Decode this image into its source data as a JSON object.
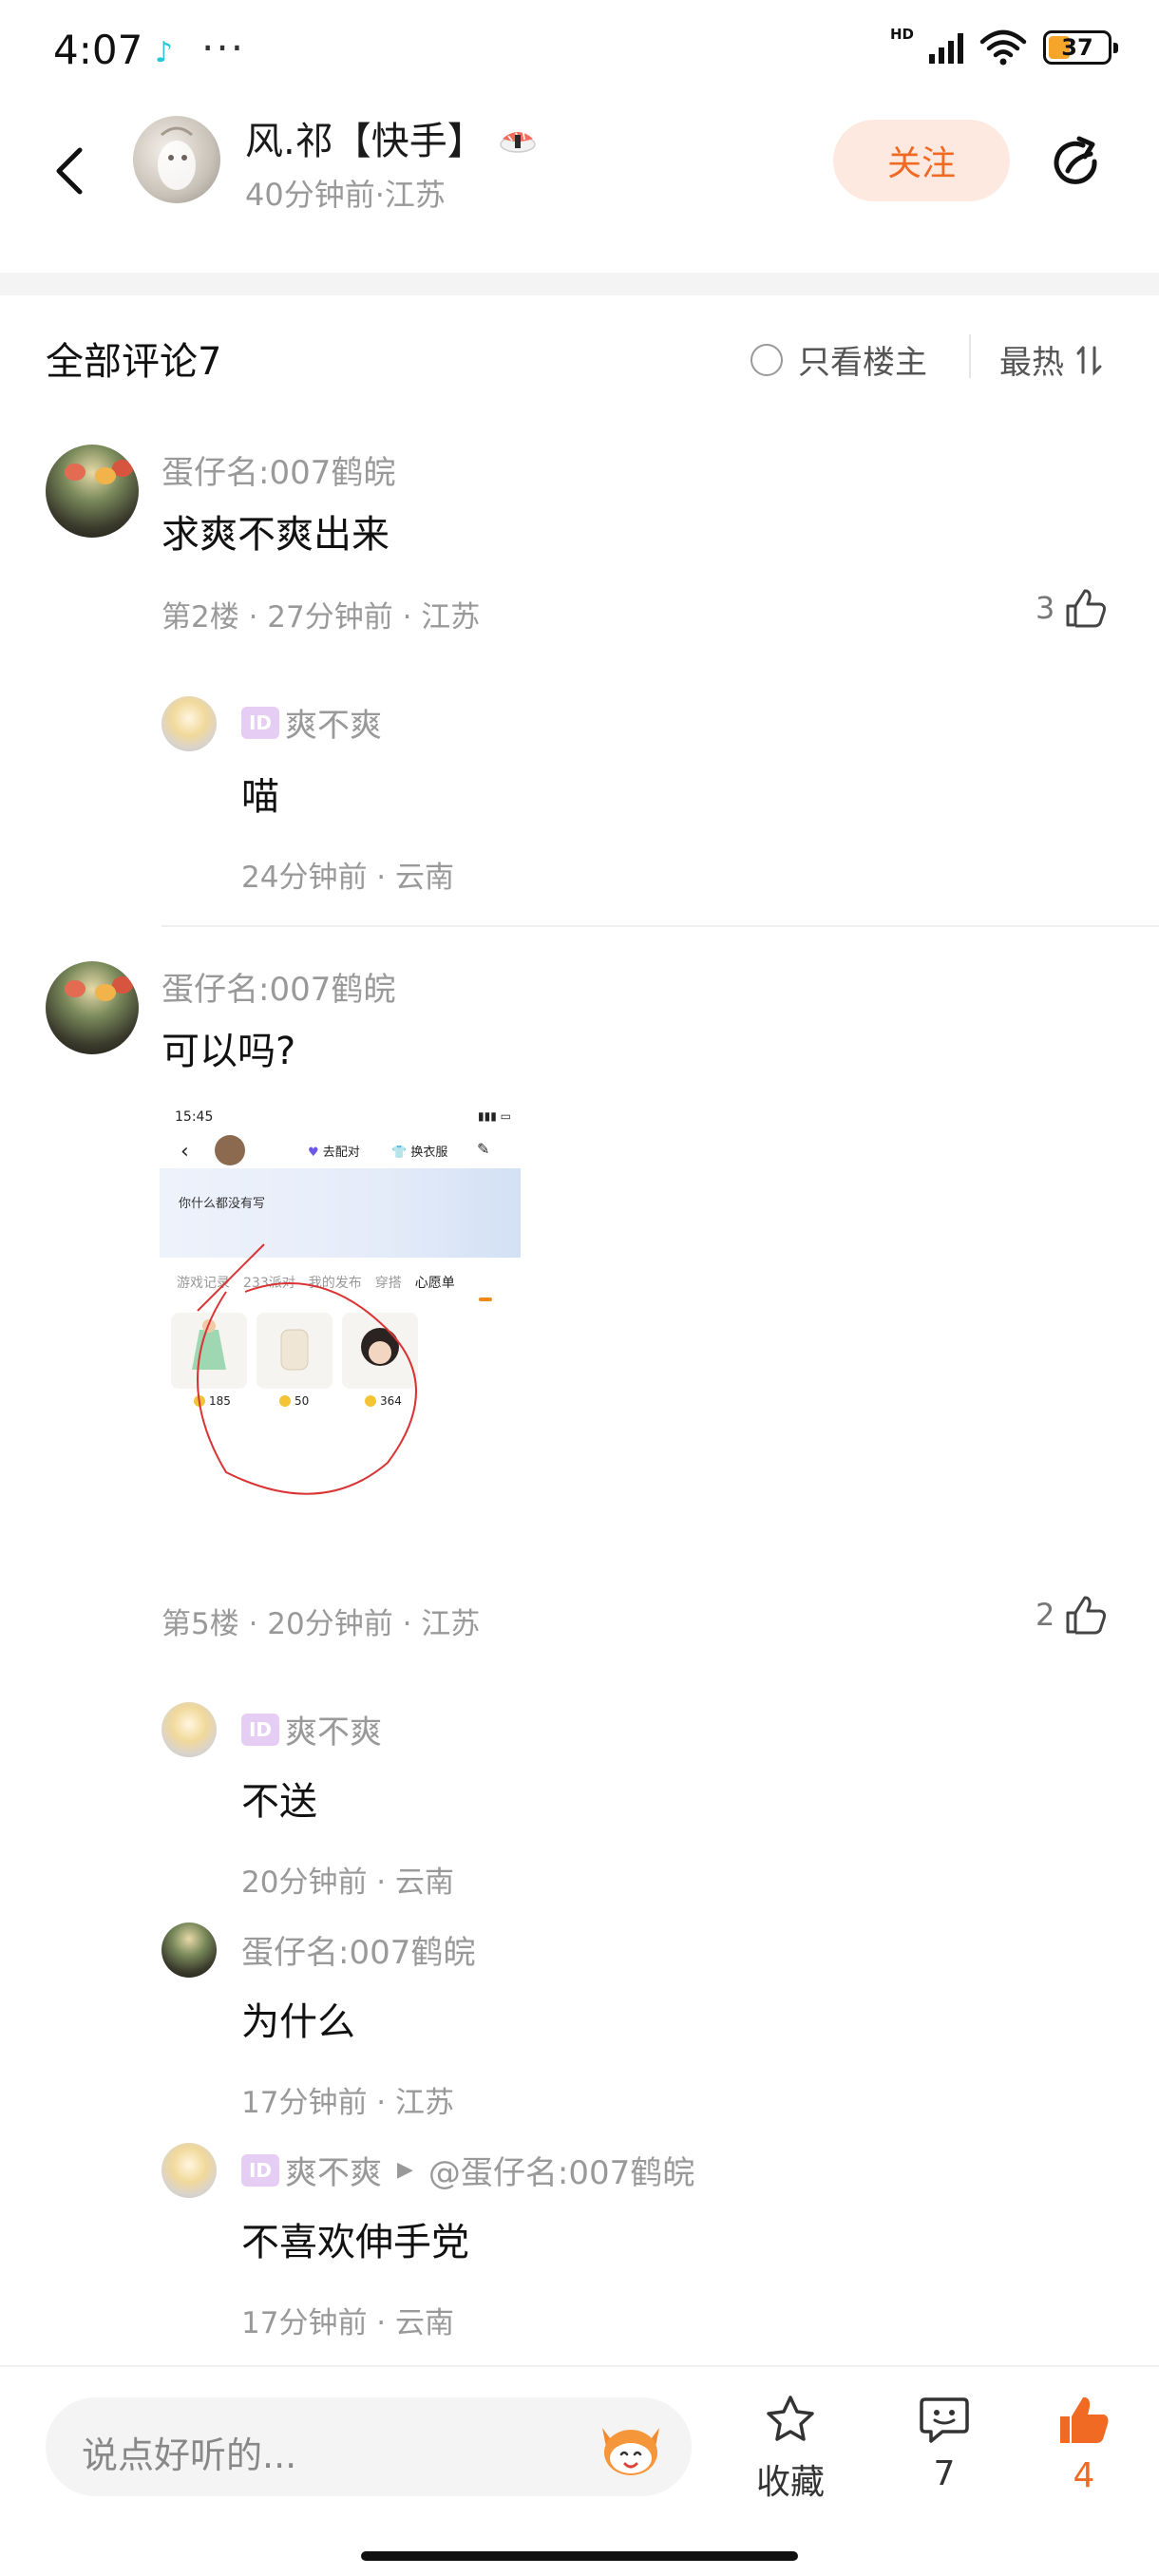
{
  "status_bar": {
    "time": "4:07",
    "dots": "···",
    "hd_label": "HD",
    "battery": "37",
    "battery_level": 0.37
  },
  "header": {
    "author_name": "风.祁【快手】",
    "author_meta": "40分钟前·江苏",
    "follow_label": "关注"
  },
  "comments_header": {
    "title": "全部评论7",
    "only_owner_label": "只看楼主",
    "sort_label": "最热"
  },
  "comments": [
    {
      "user": "蛋仔名:007鹤皖",
      "text": "求爽不爽出来",
      "meta": "第2楼 · 27分钟前 · 江苏",
      "likes": "3",
      "replies": [
        {
          "user": "爽不爽",
          "id_badge": "ID",
          "text": "喵",
          "meta": "24分钟前 · 云南"
        }
      ]
    },
    {
      "user": "蛋仔名:007鹤皖",
      "text": "可以吗?",
      "meta": "第5楼 · 20分钟前 · 江苏",
      "likes": "2",
      "embedded_screenshot": {
        "time": "15:45",
        "pair_label": "去配对",
        "clothes_label": "换衣服",
        "banner_text": "你什么都没有写",
        "tabs": [
          "游戏记录",
          "233派对",
          "我的发布",
          "穿搭",
          "心愿单"
        ],
        "prices": [
          "185",
          "50",
          "364"
        ]
      },
      "replies": [
        {
          "user": "爽不爽",
          "id_badge": "ID",
          "text": "不送",
          "meta": "20分钟前 · 云南"
        },
        {
          "user": "蛋仔名:007鹤皖",
          "text": "为什么",
          "meta": "17分钟前 · 江苏"
        },
        {
          "user": "爽不爽",
          "id_badge": "ID",
          "reply_to": "@蛋仔名:007鹤皖",
          "text": "不喜欢伸手党",
          "meta": "17分钟前 · 云南"
        }
      ]
    }
  ],
  "bottom_bar": {
    "input_placeholder": "说点好听的...",
    "favorite_label": "收藏",
    "comment_count": "7",
    "like_count": "4"
  },
  "colors": {
    "accent": "#f06a24",
    "follow_bg": "#fde9e0",
    "muted_text": "#999999",
    "id_badge": "#e6cdf3"
  },
  "icons": [
    "back-arrow-icon",
    "share-icon",
    "sushi-icon",
    "radio-icon",
    "sort-icon",
    "thumbs-up-icon",
    "star-icon",
    "comment-icon",
    "mascot-icon"
  ]
}
